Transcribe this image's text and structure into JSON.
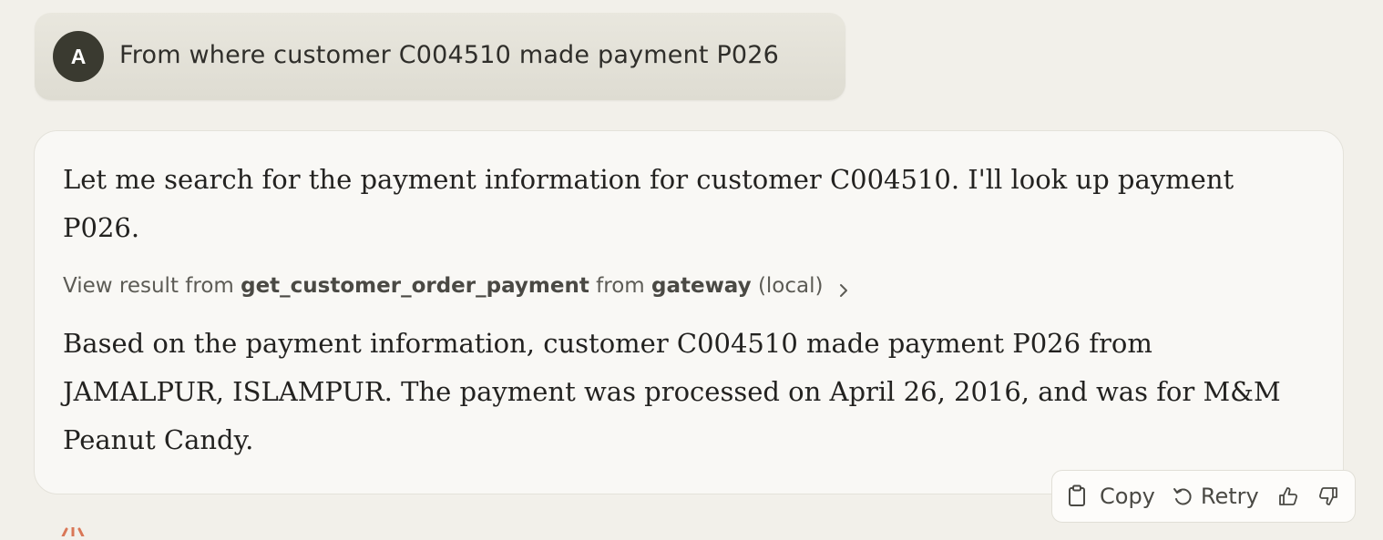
{
  "user_message": {
    "avatar_initial": "A",
    "text": "From where customer C004510 made payment P026"
  },
  "assistant_message": {
    "intro": "Let me search for the payment information for customer C004510. I'll look up payment P026.",
    "tool_result": {
      "prefix": "View result from",
      "tool_name": "get_customer_order_payment",
      "middle": "from",
      "server_name": "gateway",
      "suffix": "(local)"
    },
    "answer": "Based on the payment information, customer C004510 made payment P026 from JAMALPUR, ISLAMPUR. The payment was processed on April 26, 2016, and was for M&M Peanut Candy."
  },
  "actions": {
    "copy_label": "Copy",
    "retry_label": "Retry"
  },
  "colors": {
    "background": "#f2f0ea",
    "avatar": "#3a3a30",
    "brand_accent": "#d97757"
  },
  "icons": [
    "clipboard-icon",
    "retry-icon",
    "thumbs-up-icon",
    "thumbs-down-icon",
    "chevron-right-icon",
    "assistant-logo-icon"
  ]
}
